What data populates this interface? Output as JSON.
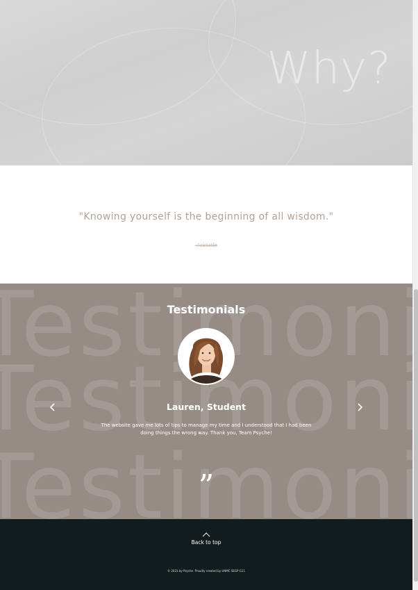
{
  "hero": {
    "title": "Why?"
  },
  "quote": {
    "text": "\"Knowing yourself is the beginning of all wisdom.\"",
    "author": "-Aristotle"
  },
  "testimonials": {
    "background_word": "Testimonials",
    "heading": "Testimonials",
    "name": "Lauren, Student",
    "text": "The website gave me lots of tips to manage my time and I understood that I had been doing things the wrong way. Thank you, Team Psyche!",
    "prev_icon": "chevron-left-icon",
    "next_icon": "chevron-right-icon",
    "quote_mark": "”"
  },
  "footer": {
    "back_to_top": "Back to top",
    "copyright": "© 2021 by Psyche. Proudly created by UNMC SEGP G11"
  },
  "colors": {
    "hero_bg": "#d3d3d3",
    "quote_text": "#b3a296",
    "testimonials_bg": "#978b86",
    "footer_bg": "#121c1d"
  }
}
